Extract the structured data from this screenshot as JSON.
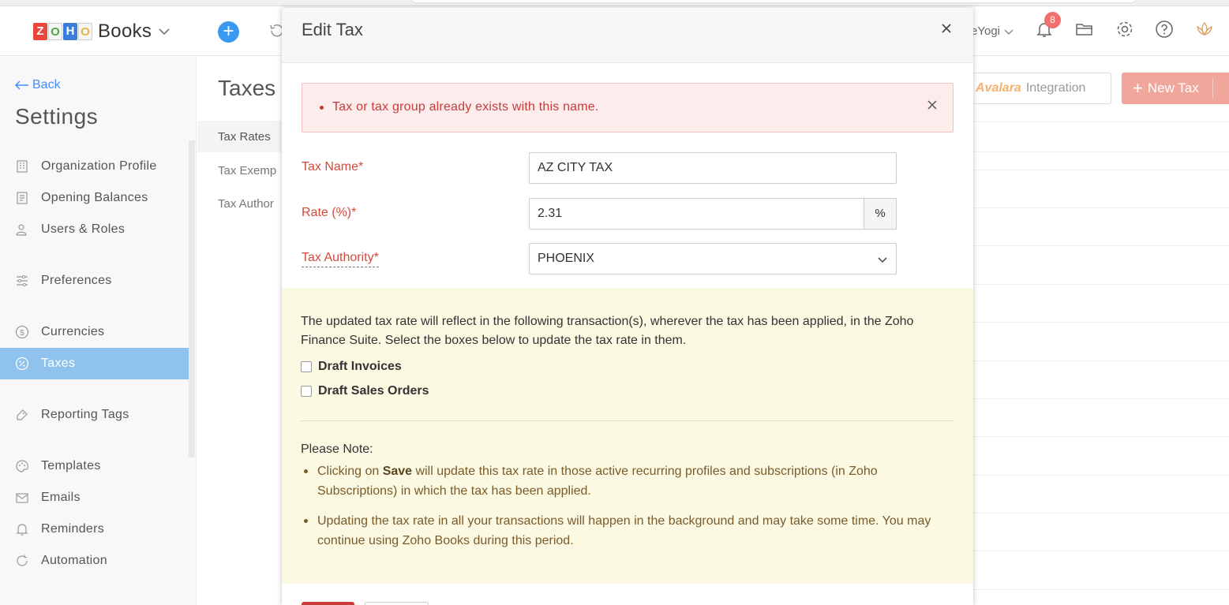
{
  "app": {
    "product_name": "Books",
    "org_name": "eYogi",
    "notification_count": "8"
  },
  "sidebar": {
    "back_label": "Back",
    "title": "Settings",
    "items": [
      {
        "label": "Organization Profile",
        "icon": "building-icon"
      },
      {
        "label": "Opening Balances",
        "icon": "ledger-icon"
      },
      {
        "label": "Users & Roles",
        "icon": "users-icon"
      },
      {
        "label": "Preferences",
        "icon": "sliders-icon"
      },
      {
        "label": "Currencies",
        "icon": "currency-icon"
      },
      {
        "label": "Taxes",
        "icon": "tax-icon",
        "active": true
      },
      {
        "label": "Reporting Tags",
        "icon": "tag-icon"
      },
      {
        "label": "Templates",
        "icon": "palette-icon"
      },
      {
        "label": "Emails",
        "icon": "email-icon"
      },
      {
        "label": "Reminders",
        "icon": "bell-icon"
      },
      {
        "label": "Automation",
        "icon": "refresh-icon"
      }
    ]
  },
  "page": {
    "title": "Taxes",
    "subnav": [
      "Tax Rates",
      "Tax Exemp",
      "Tax Author"
    ],
    "avalara_brand": "Avalara",
    "avalara_label": "Integration",
    "new_tax_label": "New Tax"
  },
  "modal": {
    "title": "Edit Tax",
    "error_message": "Tax or tax group already exists with this name.",
    "fields": {
      "tax_name_label": "Tax Name*",
      "tax_name_value": "AZ CITY TAX",
      "rate_label": "Rate (%)*",
      "rate_value": "2.31",
      "rate_addon": "%",
      "authority_label": "Tax Authority*",
      "authority_value": "PHOENIX"
    },
    "notice": {
      "text": "The updated tax rate will reflect in the following transaction(s), wherever the tax has been applied, in the Zoho Finance Suite. Select the boxes below to update the tax rate in them.",
      "checkboxes": [
        "Draft Invoices",
        "Draft Sales Orders"
      ],
      "note_heading": "Please Note:",
      "bullet1_pre": "Clicking on ",
      "bullet1_bold": "Save",
      "bullet1_post": " will update this tax rate in those active recurring profiles and subscriptions (in Zoho Subscriptions) in which the tax has been applied.",
      "bullet2": "Updating the tax rate in all your transactions will happen in the background and may take some time. You may continue using Zoho Books during this period."
    }
  },
  "colors": {
    "accent_blue": "#408dfb",
    "active_nav": "#8fc3ee",
    "error_red": "#d14a3d",
    "notice_bg": "#fcf9e3",
    "new_tax_bg": "#f0a69a"
  }
}
